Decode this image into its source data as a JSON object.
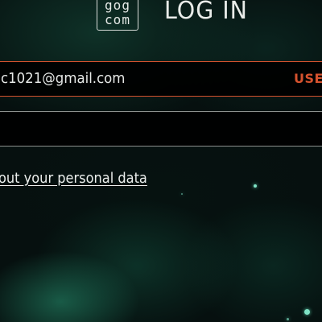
{
  "header": {
    "logo_line1": "gog",
    "logo_line2": "com",
    "title": "LOG IN"
  },
  "login_form": {
    "email_value": "c1021@gmail.com",
    "email_tag": "USE",
    "password_value": "",
    "privacy_link": "out your personal data"
  },
  "colors": {
    "accent": "#d4522e",
    "text": "#e9ece9",
    "background": "#06100f"
  }
}
